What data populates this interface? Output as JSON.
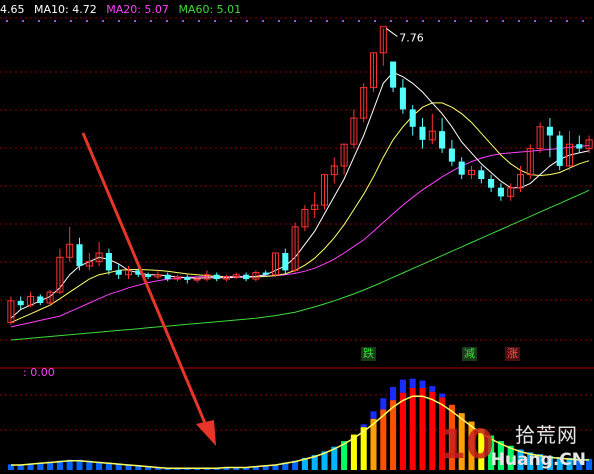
{
  "legend": {
    "ma5": "4.65",
    "ma10": "MA10: 4.72",
    "ma20": "MA20: 5.07",
    "ma60": "MA60: 5.01"
  },
  "colors": {
    "ma5": "#ffffff",
    "ma10": "#ffff66",
    "ma20": "#ff40ff",
    "ma60": "#3cdc3c",
    "up": "#ff3232",
    "down": "#54ffff",
    "grid": "#8c0000",
    "arrow": "#e8352a"
  },
  "sub_legend": ": 0.00",
  "tags": {
    "die": "跌",
    "jian": "减",
    "zhang": "涨"
  },
  "watermark": {
    "logo": "10",
    "cn": "拾荒网",
    "url": "Huang.CN"
  },
  "chart_data": [
    {
      "type": "candlestick",
      "peak_label": "7.76",
      "candles": [
        [
          1.0,
          1.5,
          0.95,
          1.6
        ],
        [
          1.5,
          1.4,
          1.3,
          1.6
        ],
        [
          1.4,
          1.6,
          1.35,
          1.7
        ],
        [
          1.6,
          1.45,
          1.4,
          1.65
        ],
        [
          1.45,
          1.7,
          1.4,
          1.75
        ],
        [
          1.7,
          2.5,
          1.65,
          2.7
        ],
        [
          2.5,
          2.8,
          2.4,
          3.2
        ],
        [
          2.8,
          2.3,
          2.2,
          2.95
        ],
        [
          2.3,
          2.4,
          2.2,
          2.6
        ],
        [
          2.4,
          2.6,
          2.3,
          2.85
        ],
        [
          2.6,
          2.2,
          2.1,
          2.7
        ],
        [
          2.2,
          2.1,
          2.0,
          2.35
        ],
        [
          2.1,
          2.2,
          2.0,
          2.3
        ],
        [
          2.2,
          2.1,
          2.05,
          2.25
        ],
        [
          2.1,
          2.05,
          2.0,
          2.15
        ],
        [
          2.05,
          2.1,
          2.0,
          2.2
        ],
        [
          2.1,
          2.0,
          1.95,
          2.15
        ],
        [
          2.0,
          2.05,
          1.95,
          2.1
        ],
        [
          2.05,
          1.98,
          1.9,
          2.1
        ],
        [
          1.98,
          2.0,
          1.92,
          2.05
        ],
        [
          2.0,
          2.1,
          1.95,
          2.2
        ],
        [
          2.1,
          2.0,
          1.95,
          2.15
        ],
        [
          2.0,
          2.05,
          1.95,
          2.1
        ],
        [
          2.05,
          2.1,
          2.0,
          2.15
        ],
        [
          2.1,
          2.0,
          1.95,
          2.15
        ],
        [
          2.0,
          2.15,
          1.95,
          2.2
        ],
        [
          2.15,
          2.1,
          2.05,
          2.2
        ],
        [
          2.1,
          2.6,
          2.05,
          2.6
        ],
        [
          2.6,
          2.2,
          2.1,
          2.7
        ],
        [
          2.2,
          3.2,
          2.15,
          3.3
        ],
        [
          3.2,
          3.6,
          3.1,
          3.7
        ],
        [
          3.6,
          3.7,
          3.4,
          4.0
        ],
        [
          3.7,
          4.4,
          3.6,
          4.4
        ],
        [
          4.4,
          4.6,
          4.2,
          4.8
        ],
        [
          4.6,
          5.1,
          4.4,
          5.1
        ],
        [
          5.1,
          5.7,
          5.0,
          5.9
        ],
        [
          5.7,
          6.4,
          5.6,
          6.5
        ],
        [
          6.4,
          7.2,
          6.3,
          7.2
        ],
        [
          7.2,
          7.8,
          6.9,
          7.76
        ],
        [
          7.0,
          6.4,
          6.3,
          7.0
        ],
        [
          6.4,
          5.9,
          5.8,
          6.6
        ],
        [
          5.9,
          5.5,
          5.3,
          6.0
        ],
        [
          5.5,
          5.2,
          5.0,
          5.7
        ],
        [
          5.2,
          5.4,
          5.1,
          5.8
        ],
        [
          5.4,
          5.0,
          4.9,
          5.7
        ],
        [
          5.0,
          4.7,
          4.6,
          5.2
        ],
        [
          4.7,
          4.4,
          4.3,
          4.8
        ],
        [
          4.4,
          4.5,
          4.3,
          4.6
        ],
        [
          4.5,
          4.3,
          4.2,
          4.6
        ],
        [
          4.3,
          4.1,
          4.0,
          4.4
        ],
        [
          4.1,
          3.9,
          3.8,
          4.2
        ],
        [
          3.9,
          4.1,
          3.8,
          4.2
        ],
        [
          4.1,
          4.4,
          4.0,
          4.6
        ],
        [
          4.4,
          5.0,
          4.3,
          5.1
        ],
        [
          5.0,
          5.5,
          4.9,
          5.6
        ],
        [
          5.5,
          5.3,
          4.8,
          5.7
        ],
        [
          5.3,
          4.6,
          4.5,
          5.4
        ],
        [
          4.6,
          5.1,
          4.5,
          5.4
        ],
        [
          5.1,
          5.0,
          4.9,
          5.3
        ],
        [
          5.0,
          5.2,
          4.9,
          5.3
        ]
      ],
      "ma5": [
        1.1,
        1.3,
        1.4,
        1.5,
        1.6,
        1.8,
        2.1,
        2.3,
        2.4,
        2.5,
        2.45,
        2.35,
        2.2,
        2.15,
        2.1,
        2.1,
        2.07,
        2.05,
        2.03,
        2.02,
        2.03,
        2.03,
        2.03,
        2.04,
        2.05,
        2.06,
        2.1,
        2.2,
        2.3,
        2.5,
        2.8,
        3.1,
        3.5,
        3.9,
        4.3,
        4.8,
        5.3,
        5.9,
        6.5,
        6.75,
        6.65,
        6.5,
        6.3,
        6.05,
        5.8,
        5.5,
        5.15,
        4.9,
        4.65,
        4.45,
        4.25,
        4.1,
        4.1,
        4.2,
        4.4,
        4.6,
        4.75,
        4.85,
        4.9,
        4.95
      ],
      "ma10": [
        1.0,
        1.1,
        1.2,
        1.3,
        1.4,
        1.55,
        1.7,
        1.85,
        2.0,
        2.1,
        2.15,
        2.2,
        2.22,
        2.22,
        2.21,
        2.2,
        2.18,
        2.15,
        2.12,
        2.1,
        2.08,
        2.06,
        2.05,
        2.05,
        2.04,
        2.05,
        2.06,
        2.08,
        2.12,
        2.2,
        2.32,
        2.48,
        2.7,
        2.95,
        3.25,
        3.6,
        3.95,
        4.35,
        4.8,
        5.2,
        5.5,
        5.75,
        5.95,
        6.05,
        6.05,
        5.95,
        5.8,
        5.6,
        5.35,
        5.1,
        4.85,
        4.65,
        4.5,
        4.4,
        4.38,
        4.4,
        4.45,
        4.55,
        4.65,
        4.72
      ],
      "ma20": [
        0.9,
        0.95,
        1.0,
        1.05,
        1.1,
        1.15,
        1.25,
        1.35,
        1.45,
        1.55,
        1.65,
        1.72,
        1.8,
        1.86,
        1.92,
        1.96,
        2.0,
        2.02,
        2.04,
        2.05,
        2.06,
        2.06,
        2.06,
        2.06,
        2.06,
        2.06,
        2.07,
        2.08,
        2.1,
        2.13,
        2.18,
        2.25,
        2.35,
        2.46,
        2.6,
        2.75,
        2.9,
        3.1,
        3.3,
        3.5,
        3.7,
        3.88,
        4.05,
        4.2,
        4.35,
        4.48,
        4.6,
        4.7,
        4.78,
        4.84,
        4.88,
        4.9,
        4.92,
        4.94,
        4.96,
        4.98,
        5.0,
        5.03,
        5.05,
        5.07
      ],
      "ma60": [
        0.6,
        0.62,
        0.64,
        0.66,
        0.68,
        0.7,
        0.72,
        0.74,
        0.76,
        0.78,
        0.8,
        0.82,
        0.84,
        0.86,
        0.88,
        0.9,
        0.92,
        0.94,
        0.96,
        0.98,
        1.0,
        1.02,
        1.04,
        1.06,
        1.08,
        1.1,
        1.13,
        1.16,
        1.2,
        1.24,
        1.3,
        1.36,
        1.43,
        1.5,
        1.58,
        1.66,
        1.75,
        1.84,
        1.94,
        2.04,
        2.14,
        2.24,
        2.34,
        2.44,
        2.54,
        2.64,
        2.74,
        2.84,
        2.94,
        3.04,
        3.14,
        3.24,
        3.34,
        3.44,
        3.54,
        3.64,
        3.74,
        3.84,
        3.94,
        4.04
      ]
    },
    {
      "type": "bar",
      "value_label": "0.00",
      "bars": [
        6,
        6,
        7,
        8,
        9,
        10,
        11,
        11,
        10,
        9,
        8,
        7,
        6,
        5,
        4,
        3,
        2,
        2,
        2,
        2,
        2,
        2,
        3,
        3,
        3,
        4,
        5,
        6,
        8,
        10,
        13,
        16,
        20,
        25,
        31,
        38,
        46,
        55,
        65,
        75,
        83,
        88,
        88,
        84,
        78,
        70,
        61,
        52,
        44,
        37,
        31,
        26,
        22,
        19,
        17,
        15,
        14,
        13,
        12,
        12
      ],
      "overlay_top": [
        0,
        0,
        0,
        0,
        0,
        0,
        0,
        0,
        0,
        0,
        0,
        0,
        0,
        0,
        0,
        0,
        0,
        0,
        0,
        0,
        0,
        0,
        0,
        0,
        0,
        0,
        0,
        0,
        0,
        0,
        0,
        0,
        0,
        0,
        0,
        0,
        3,
        8,
        12,
        14,
        14,
        10,
        8,
        6,
        4,
        0,
        0,
        0,
        0,
        0,
        0,
        0,
        0,
        0,
        0,
        0,
        0,
        0,
        0,
        0
      ]
    }
  ]
}
